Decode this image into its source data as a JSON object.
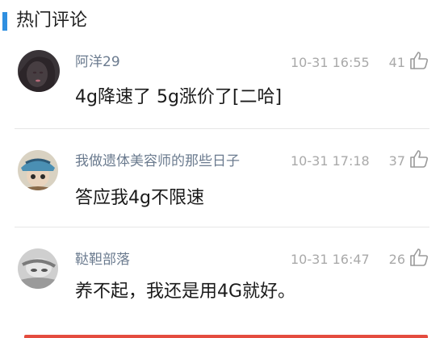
{
  "header": {
    "title": "热门评论",
    "accent_color": "#2f8fe0"
  },
  "comments": [
    {
      "username": "阿洋29",
      "time": "10-31 16:55",
      "likes": "41",
      "text": "4g降速了 5g涨价了[二哈]"
    },
    {
      "username": "我做遗体美容师的那些日子",
      "time": "10-31 17:18",
      "likes": "37",
      "text": "答应我4g不限速"
    },
    {
      "username": "鞑靼部落",
      "time": "10-31 16:47",
      "likes": "26",
      "text": "养不起，我还是用4G就好。"
    }
  ],
  "icons": {
    "like": "thumbs-up-icon",
    "avatar": "avatar"
  },
  "colors": {
    "username": "#6b7b8f",
    "meta": "#a9a9a9",
    "text": "#1a1a1a"
  }
}
